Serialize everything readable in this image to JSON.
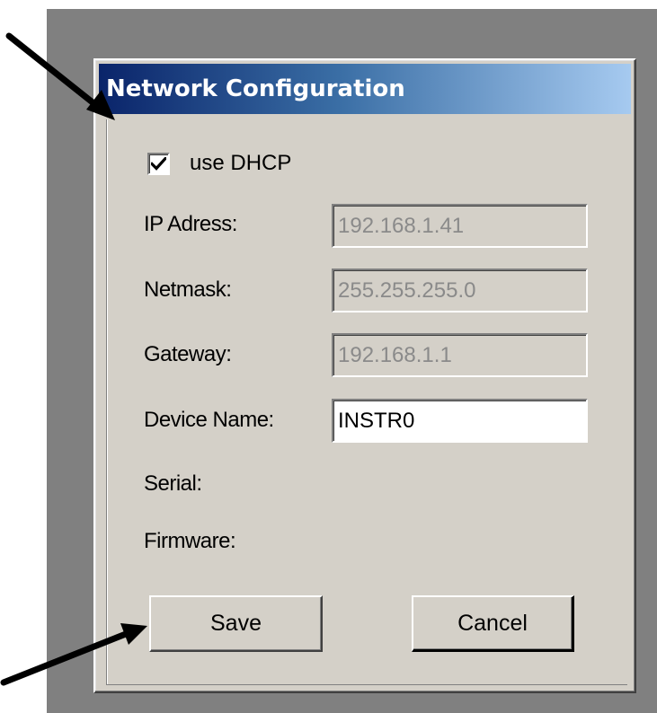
{
  "dialog": {
    "title": "Network Configuration"
  },
  "dhcp": {
    "label": "use DHCP",
    "checked": true
  },
  "fields": {
    "ip": {
      "label": "IP Adress:",
      "value": "192.168.1.41",
      "enabled": false
    },
    "netmask": {
      "label": "Netmask:",
      "value": "255.255.255.0",
      "enabled": false
    },
    "gateway": {
      "label": "Gateway:",
      "value": "192.168.1.1",
      "enabled": false
    },
    "device_name": {
      "label": "Device Name:",
      "value": "INSTR0",
      "enabled": true
    }
  },
  "info": {
    "serial_label": "Serial:",
    "firmware_label": "Firmware:"
  },
  "buttons": {
    "save_label": "Save",
    "cancel_label": "Cancel"
  },
  "annotations": {
    "arrow_color": "#000000"
  },
  "colors": {
    "title_gradient_start": "#0a246a",
    "title_gradient_end": "#a6caf0",
    "dialog_background": "#d4d0c8",
    "backdrop": "#808080"
  }
}
